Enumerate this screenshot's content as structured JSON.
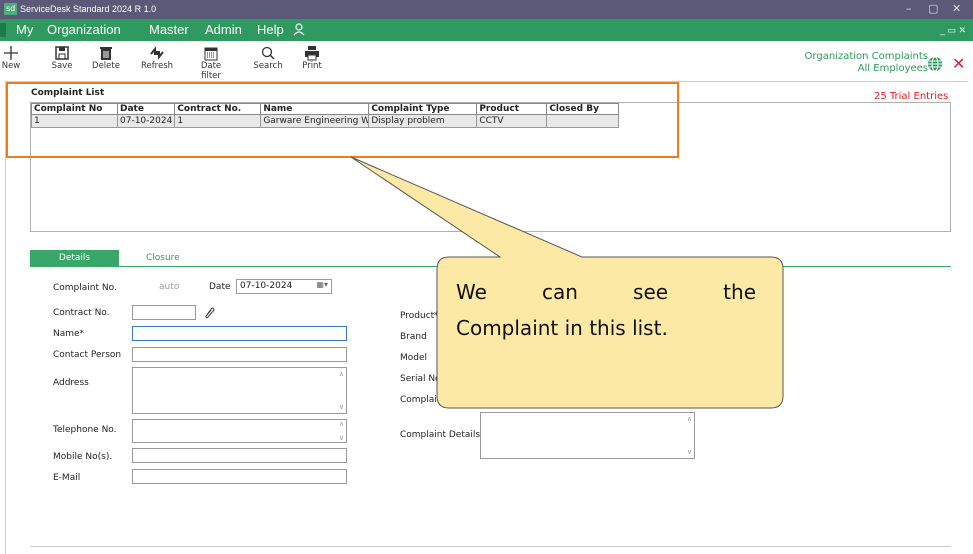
{
  "window": {
    "title": "ServiceDesk Standard 2024 R 1.0",
    "logo": "sd",
    "minimize": "–",
    "restore": "▢",
    "close": "✕"
  },
  "menu": {
    "items": [
      "My",
      "Organization",
      "Master",
      "Admin",
      "Help"
    ],
    "user_icon": "user-icon",
    "right": "_ ▭ ✕"
  },
  "toolbar": {
    "new": "New",
    "save": "Save",
    "delete": "Delete",
    "refresh": "Refresh",
    "date_filter": "Date filter",
    "search": "Search",
    "print": "Print"
  },
  "header": {
    "title_line1": "Organization Complaints",
    "title_line2": "All Employees",
    "trial": "25 Trial Entries"
  },
  "list": {
    "title": "Complaint List",
    "columns": [
      "Complaint No",
      "Date",
      "Contract No.",
      "Name",
      "Complaint Type",
      "Product",
      "Closed By"
    ],
    "rows": [
      [
        "1",
        "07-10-2024",
        "1",
        "Garware Engineering W...",
        "Display problem",
        "CCTV",
        ""
      ]
    ]
  },
  "tabs": {
    "details": "Details",
    "closure": "Closure"
  },
  "form": {
    "complaint_no_label": "Complaint No.",
    "complaint_no_value": "auto",
    "date_label": "Date",
    "date_value": "07-10-2024",
    "contract_label": "Contract No.",
    "name_label": "Name*",
    "contact_label": "Contact Person",
    "address_label": "Address",
    "telephone_label": "Telephone No.",
    "mobile_label": "Mobile No(s).",
    "email_label": "E-Mail",
    "product_label": "Product*",
    "brand_label": "Brand",
    "model_label": "Model",
    "serial_label": "Serial No",
    "complaint_type_label": "Complaint Type",
    "complaint_details_label": "Complaint Details"
  },
  "callout": {
    "line1": [
      "We",
      "can",
      "see",
      "the"
    ],
    "line2": "Complaint in this list."
  },
  "colors": {
    "menu": "#2e9a5f",
    "titlebar": "#5a5a78",
    "highlight": "#f07c20",
    "callout_fill": "#fde9a6",
    "trial": "#e0202a"
  }
}
